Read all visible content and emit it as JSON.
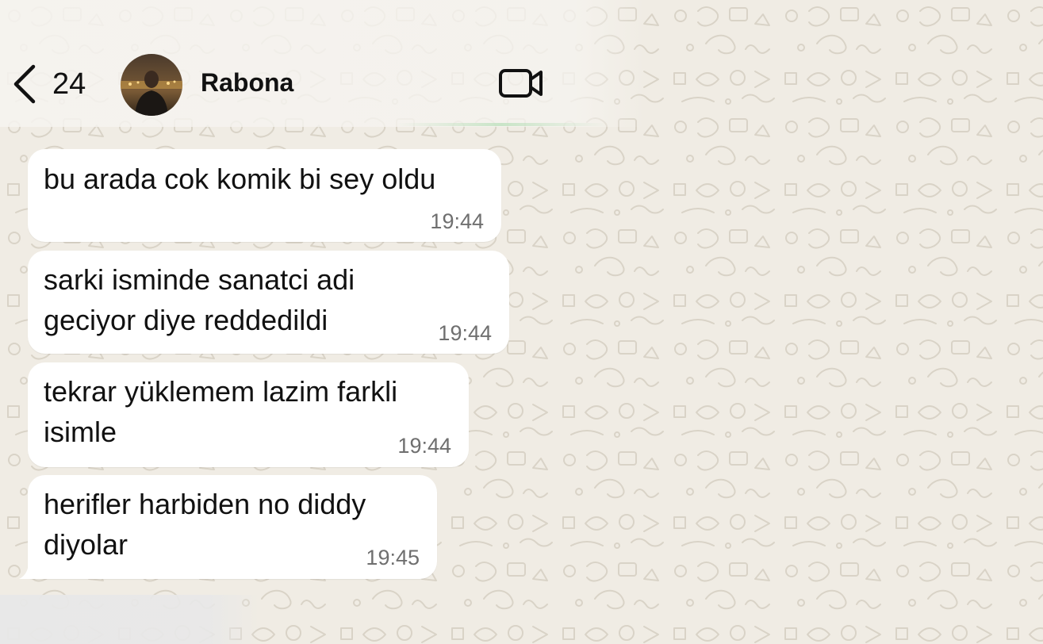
{
  "header": {
    "back_count": "24",
    "contact_name": "Rabona",
    "icons": {
      "back": "chevron-left-icon",
      "video": "video-camera-icon",
      "avatar": "contact-avatar"
    }
  },
  "messages": [
    {
      "text": "bu arada cok komik bi sey oldu",
      "time": "19:44"
    },
    {
      "text": "sarki isminde sanatci adi\ngeciyor diye reddedildi",
      "time": "19:44"
    },
    {
      "text": "tekrar yüklemem lazim farkli\nisimle",
      "time": "19:44"
    },
    {
      "text": "herifler harbiden no diddy\ndiyolar",
      "time": "19:45"
    }
  ],
  "colors": {
    "chat_background": "#f0ece4",
    "bubble": "#ffffff",
    "text": "#111111",
    "timestamp": "#6f6f6f"
  }
}
